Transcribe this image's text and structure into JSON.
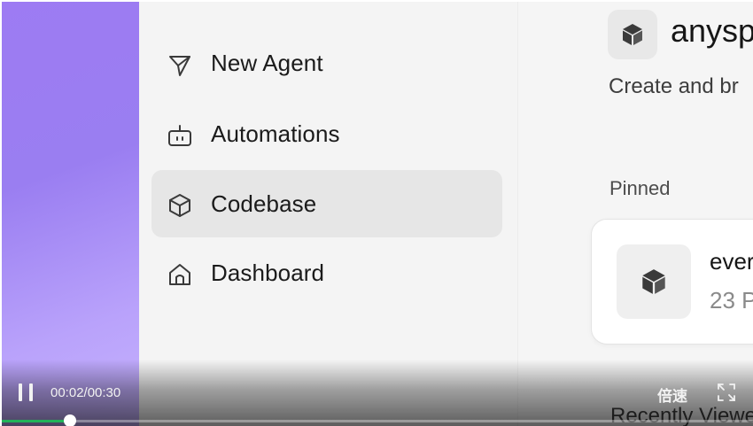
{
  "sidebar": {
    "items": [
      {
        "label": "New Agent",
        "icon": "send-icon",
        "active": false
      },
      {
        "label": "Automations",
        "icon": "robot-icon",
        "active": false
      },
      {
        "label": "Codebase",
        "icon": "cube-icon",
        "active": true
      },
      {
        "label": "Dashboard",
        "icon": "home-icon",
        "active": false
      }
    ]
  },
  "main": {
    "repo_title": "anysp",
    "repo_subtitle": "Create and br",
    "pinned_heading": "Pinned",
    "pinned_card": {
      "name": "ever",
      "meta": "23 P"
    },
    "recent_heading": "Recently Viewe"
  },
  "player": {
    "time": "00:02/00:30",
    "speed_label": "倍速",
    "progress": 0.0667,
    "progress_color": "#22b35a"
  },
  "colors": {
    "accent_purple": "#9d7bf3",
    "sidebar_bg": "#f4f4f4",
    "active_item_bg": "#e6e6e6"
  }
}
